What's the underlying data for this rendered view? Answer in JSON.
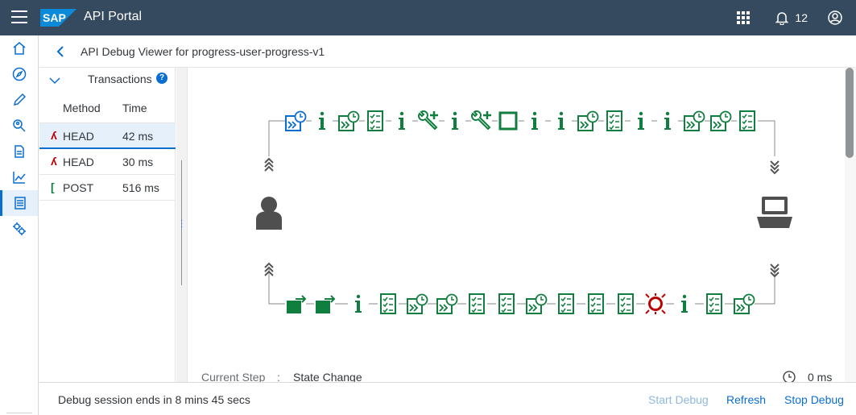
{
  "header": {
    "brand": "SAP",
    "app_title": "API Portal",
    "notification_count": "12"
  },
  "page": {
    "title": "API Debug Viewer for progress-user-progress-v1"
  },
  "transactions": {
    "title": "Transactions",
    "help": "?",
    "columns": {
      "method": "Method",
      "time": "Time"
    },
    "rows": [
      {
        "mark": "X",
        "method": "HEAD",
        "time": "42 ms",
        "status_color": "#bb0000",
        "selected": true
      },
      {
        "mark": "X",
        "method": "HEAD",
        "time": "30 ms",
        "status_color": "#bb0000",
        "selected": false
      },
      {
        "mark": "[",
        "method": "POST",
        "time": "516 ms",
        "status_color": "#107e3e",
        "selected": false
      }
    ]
  },
  "flow": {
    "current_step_label": "Current Step",
    "colon": ":",
    "current_step_value": "State Change",
    "elapsed": "0 ms",
    "request_policies": [
      "clock-policy",
      "info",
      "clock-policy",
      "checklist",
      "info",
      "tool-plus",
      "info",
      "tool-plus",
      "square",
      "info",
      "info",
      "clock-policy",
      "checklist",
      "info",
      "info",
      "clock-policy",
      "clock-policy",
      "checklist"
    ],
    "response_policies": [
      "flow-arrow",
      "flow-arrow",
      "info",
      "checklist",
      "clock-policy",
      "clock-policy",
      "checklist",
      "checklist",
      "clock-policy",
      "checklist",
      "checklist",
      "checklist",
      "error-target",
      "info",
      "checklist",
      "clock-policy"
    ],
    "colors": {
      "policy": "#107e3e",
      "active": "#0a6ed1",
      "error": "#bb0000",
      "endpoint": "#6a6d70"
    }
  },
  "footer": {
    "message": "Debug session ends in 8 mins 45 secs",
    "start_debug": "Start Debug",
    "refresh": "Refresh",
    "stop_debug": "Stop Debug"
  }
}
